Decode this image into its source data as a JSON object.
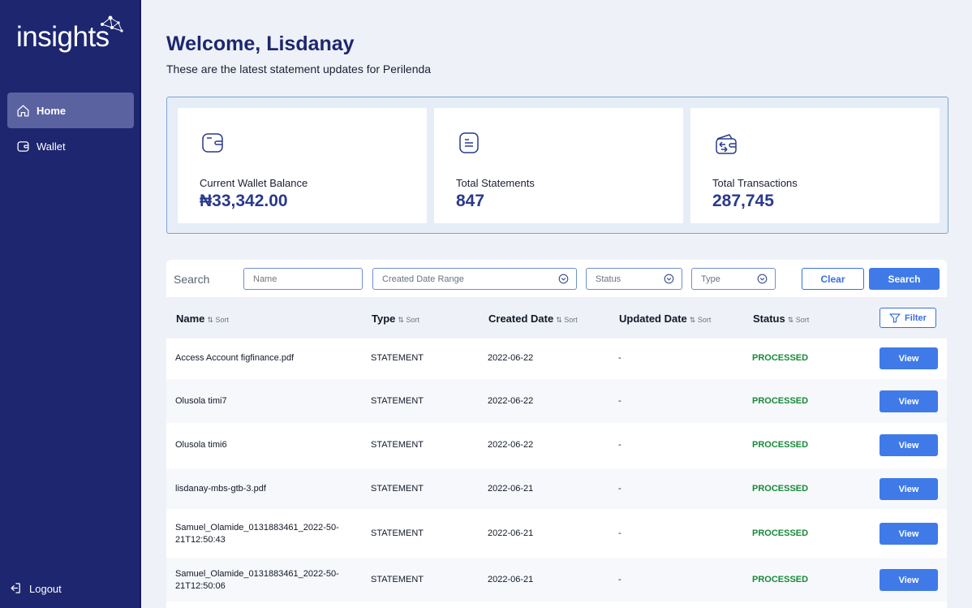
{
  "app": {
    "logo_text": "insights"
  },
  "sidebar": {
    "items": [
      {
        "label": "Home",
        "icon": "home-icon",
        "active": true
      },
      {
        "label": "Wallet",
        "icon": "wallet-icon",
        "active": false
      }
    ],
    "logout_label": "Logout"
  },
  "header": {
    "welcome": "Welcome, Lisdanay",
    "subtitle": "These are the latest statement updates for Perilenda"
  },
  "stats": [
    {
      "label": "Current Wallet Balance",
      "value": "₦33,342.00",
      "icon": "wallet-icon"
    },
    {
      "label": "Total Statements",
      "value": "847",
      "icon": "document-icon"
    },
    {
      "label": "Total Transactions",
      "value": "287,745",
      "icon": "transactions-icon"
    }
  ],
  "search": {
    "label": "Search",
    "name_placeholder": "Name",
    "date_range_placeholder": "Created Date Range",
    "status_placeholder": "Status",
    "type_placeholder": "Type",
    "clear_label": "Clear",
    "search_label": "Search"
  },
  "table": {
    "sort_label": "Sort",
    "columns": [
      "Name",
      "Type",
      "Created Date",
      "Updated Date",
      "Status"
    ],
    "filter_label": "Filter",
    "view_label": "View",
    "rows": [
      {
        "name": "Access Account figfinance.pdf",
        "type": "STATEMENT",
        "created": "2022-06-22",
        "updated": "-",
        "status": "PROCESSED"
      },
      {
        "name": "Olusola timi7",
        "type": "STATEMENT",
        "created": "2022-06-22",
        "updated": "-",
        "status": "PROCESSED"
      },
      {
        "name": "Olusola timi6",
        "type": "STATEMENT",
        "created": "2022-06-22",
        "updated": "-",
        "status": "PROCESSED"
      },
      {
        "name": "lisdanay-mbs-gtb-3.pdf",
        "type": "STATEMENT",
        "created": "2022-06-21",
        "updated": "-",
        "status": "PROCESSED"
      },
      {
        "name": "Samuel_Olamide_0131883461_2022-50-21T12:50:43",
        "type": "STATEMENT",
        "created": "2022-06-21",
        "updated": "-",
        "status": "PROCESSED"
      },
      {
        "name": "Samuel_Olamide_0131883461_2022-50-21T12:50:06",
        "type": "STATEMENT",
        "created": "2022-06-21",
        "updated": "-",
        "status": "PROCESSED"
      }
    ]
  },
  "colors": {
    "sidebar_bg": "#1e2670",
    "accent": "#3f7ae8",
    "status_processed": "#18893a",
    "heading": "#1e2670"
  }
}
